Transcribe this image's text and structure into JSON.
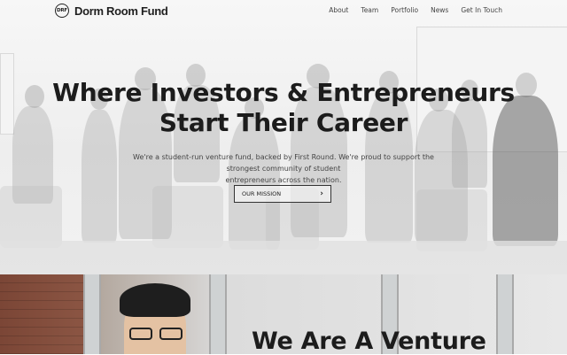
{
  "brand": {
    "mark": "DRF",
    "name": "Dorm Room Fund"
  },
  "nav": {
    "items": [
      "About",
      "Team",
      "Portfolio",
      "News",
      "Get In Touch"
    ]
  },
  "hero": {
    "headline_line1": "Where Investors & Entrepreneurs",
    "headline_line2": "Start Their Career",
    "subtext_line1": "We're a student-run venture fund, backed by First Round. We're proud to support the strongest community of student",
    "subtext_line2": "entrepreneurs across the nation.",
    "cta_label": "OUR MISSION",
    "cta_icon": "chevron-right-icon"
  },
  "section2": {
    "title": "We Are A Venture"
  }
}
